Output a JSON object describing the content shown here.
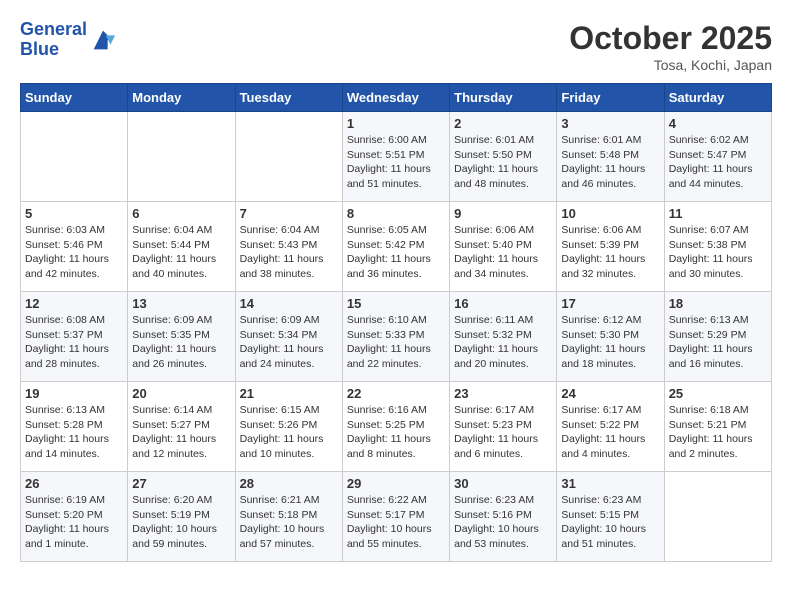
{
  "header": {
    "logo_text_general": "General",
    "logo_text_blue": "Blue",
    "month": "October 2025",
    "location": "Tosa, Kochi, Japan"
  },
  "weekdays": [
    "Sunday",
    "Monday",
    "Tuesday",
    "Wednesday",
    "Thursday",
    "Friday",
    "Saturday"
  ],
  "weeks": [
    [
      {
        "day": "",
        "info": ""
      },
      {
        "day": "",
        "info": ""
      },
      {
        "day": "",
        "info": ""
      },
      {
        "day": "1",
        "info": "Sunrise: 6:00 AM\nSunset: 5:51 PM\nDaylight: 11 hours\nand 51 minutes."
      },
      {
        "day": "2",
        "info": "Sunrise: 6:01 AM\nSunset: 5:50 PM\nDaylight: 11 hours\nand 48 minutes."
      },
      {
        "day": "3",
        "info": "Sunrise: 6:01 AM\nSunset: 5:48 PM\nDaylight: 11 hours\nand 46 minutes."
      },
      {
        "day": "4",
        "info": "Sunrise: 6:02 AM\nSunset: 5:47 PM\nDaylight: 11 hours\nand 44 minutes."
      }
    ],
    [
      {
        "day": "5",
        "info": "Sunrise: 6:03 AM\nSunset: 5:46 PM\nDaylight: 11 hours\nand 42 minutes."
      },
      {
        "day": "6",
        "info": "Sunrise: 6:04 AM\nSunset: 5:44 PM\nDaylight: 11 hours\nand 40 minutes."
      },
      {
        "day": "7",
        "info": "Sunrise: 6:04 AM\nSunset: 5:43 PM\nDaylight: 11 hours\nand 38 minutes."
      },
      {
        "day": "8",
        "info": "Sunrise: 6:05 AM\nSunset: 5:42 PM\nDaylight: 11 hours\nand 36 minutes."
      },
      {
        "day": "9",
        "info": "Sunrise: 6:06 AM\nSunset: 5:40 PM\nDaylight: 11 hours\nand 34 minutes."
      },
      {
        "day": "10",
        "info": "Sunrise: 6:06 AM\nSunset: 5:39 PM\nDaylight: 11 hours\nand 32 minutes."
      },
      {
        "day": "11",
        "info": "Sunrise: 6:07 AM\nSunset: 5:38 PM\nDaylight: 11 hours\nand 30 minutes."
      }
    ],
    [
      {
        "day": "12",
        "info": "Sunrise: 6:08 AM\nSunset: 5:37 PM\nDaylight: 11 hours\nand 28 minutes."
      },
      {
        "day": "13",
        "info": "Sunrise: 6:09 AM\nSunset: 5:35 PM\nDaylight: 11 hours\nand 26 minutes."
      },
      {
        "day": "14",
        "info": "Sunrise: 6:09 AM\nSunset: 5:34 PM\nDaylight: 11 hours\nand 24 minutes."
      },
      {
        "day": "15",
        "info": "Sunrise: 6:10 AM\nSunset: 5:33 PM\nDaylight: 11 hours\nand 22 minutes."
      },
      {
        "day": "16",
        "info": "Sunrise: 6:11 AM\nSunset: 5:32 PM\nDaylight: 11 hours\nand 20 minutes."
      },
      {
        "day": "17",
        "info": "Sunrise: 6:12 AM\nSunset: 5:30 PM\nDaylight: 11 hours\nand 18 minutes."
      },
      {
        "day": "18",
        "info": "Sunrise: 6:13 AM\nSunset: 5:29 PM\nDaylight: 11 hours\nand 16 minutes."
      }
    ],
    [
      {
        "day": "19",
        "info": "Sunrise: 6:13 AM\nSunset: 5:28 PM\nDaylight: 11 hours\nand 14 minutes."
      },
      {
        "day": "20",
        "info": "Sunrise: 6:14 AM\nSunset: 5:27 PM\nDaylight: 11 hours\nand 12 minutes."
      },
      {
        "day": "21",
        "info": "Sunrise: 6:15 AM\nSunset: 5:26 PM\nDaylight: 11 hours\nand 10 minutes."
      },
      {
        "day": "22",
        "info": "Sunrise: 6:16 AM\nSunset: 5:25 PM\nDaylight: 11 hours\nand 8 minutes."
      },
      {
        "day": "23",
        "info": "Sunrise: 6:17 AM\nSunset: 5:23 PM\nDaylight: 11 hours\nand 6 minutes."
      },
      {
        "day": "24",
        "info": "Sunrise: 6:17 AM\nSunset: 5:22 PM\nDaylight: 11 hours\nand 4 minutes."
      },
      {
        "day": "25",
        "info": "Sunrise: 6:18 AM\nSunset: 5:21 PM\nDaylight: 11 hours\nand 2 minutes."
      }
    ],
    [
      {
        "day": "26",
        "info": "Sunrise: 6:19 AM\nSunset: 5:20 PM\nDaylight: 11 hours\nand 1 minute."
      },
      {
        "day": "27",
        "info": "Sunrise: 6:20 AM\nSunset: 5:19 PM\nDaylight: 10 hours\nand 59 minutes."
      },
      {
        "day": "28",
        "info": "Sunrise: 6:21 AM\nSunset: 5:18 PM\nDaylight: 10 hours\nand 57 minutes."
      },
      {
        "day": "29",
        "info": "Sunrise: 6:22 AM\nSunset: 5:17 PM\nDaylight: 10 hours\nand 55 minutes."
      },
      {
        "day": "30",
        "info": "Sunrise: 6:23 AM\nSunset: 5:16 PM\nDaylight: 10 hours\nand 53 minutes."
      },
      {
        "day": "31",
        "info": "Sunrise: 6:23 AM\nSunset: 5:15 PM\nDaylight: 10 hours\nand 51 minutes."
      },
      {
        "day": "",
        "info": ""
      }
    ]
  ]
}
